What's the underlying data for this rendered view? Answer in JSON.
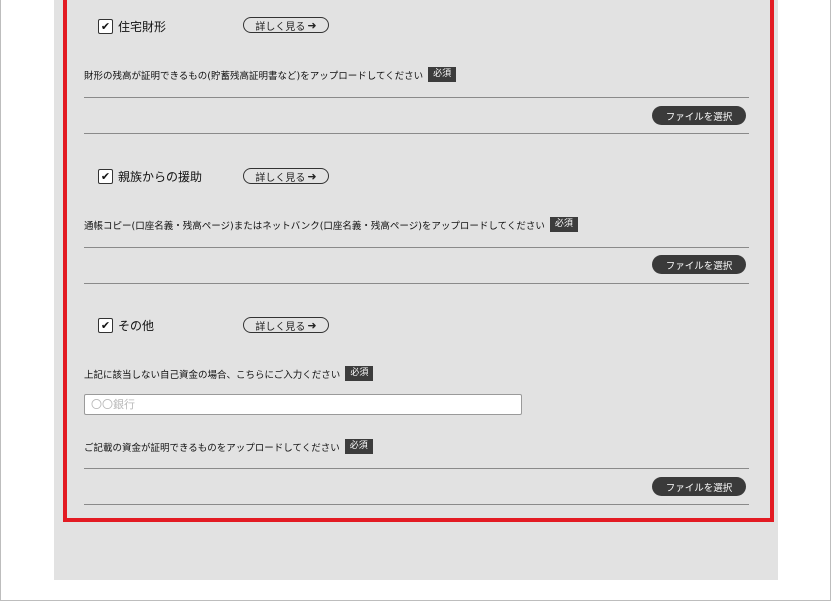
{
  "sections": [
    {
      "checkbox_label": "住宅財形",
      "checked_mark": "✔",
      "detail_label": "詳しく見る",
      "detail_arrow": "➜",
      "instruction": "財形の残高が証明できるもの(貯蓄残高証明書など)をアップロードしてください",
      "required_label": "必須",
      "file_button_label": "ファイルを選択"
    },
    {
      "checkbox_label": "親族からの援助",
      "checked_mark": "✔",
      "detail_label": "詳しく見る",
      "detail_arrow": "➜",
      "instruction": "通帳コピー(口座名義・残高ページ)またはネットバンク(口座名義・残高ページ)をアップロードしてください",
      "required_label": "必須",
      "file_button_label": "ファイルを選択"
    },
    {
      "checkbox_label": "その他",
      "checked_mark": "✔",
      "detail_label": "詳しく見る",
      "detail_arrow": "➜",
      "other_instruction": "上記に該当しない自己資金の場合、こちらにご入力ください",
      "other_required_label": "必須",
      "input_placeholder": "〇〇銀行",
      "input_value": "",
      "instruction": "ご記載の資金が証明できるものをアップロードしてください",
      "required_label": "必須",
      "file_button_label": "ファイルを選択"
    }
  ],
  "colors": {
    "highlight_border": "#e31b23",
    "panel_background": "#e2e2e2",
    "button_dark": "#3a3a3a"
  }
}
